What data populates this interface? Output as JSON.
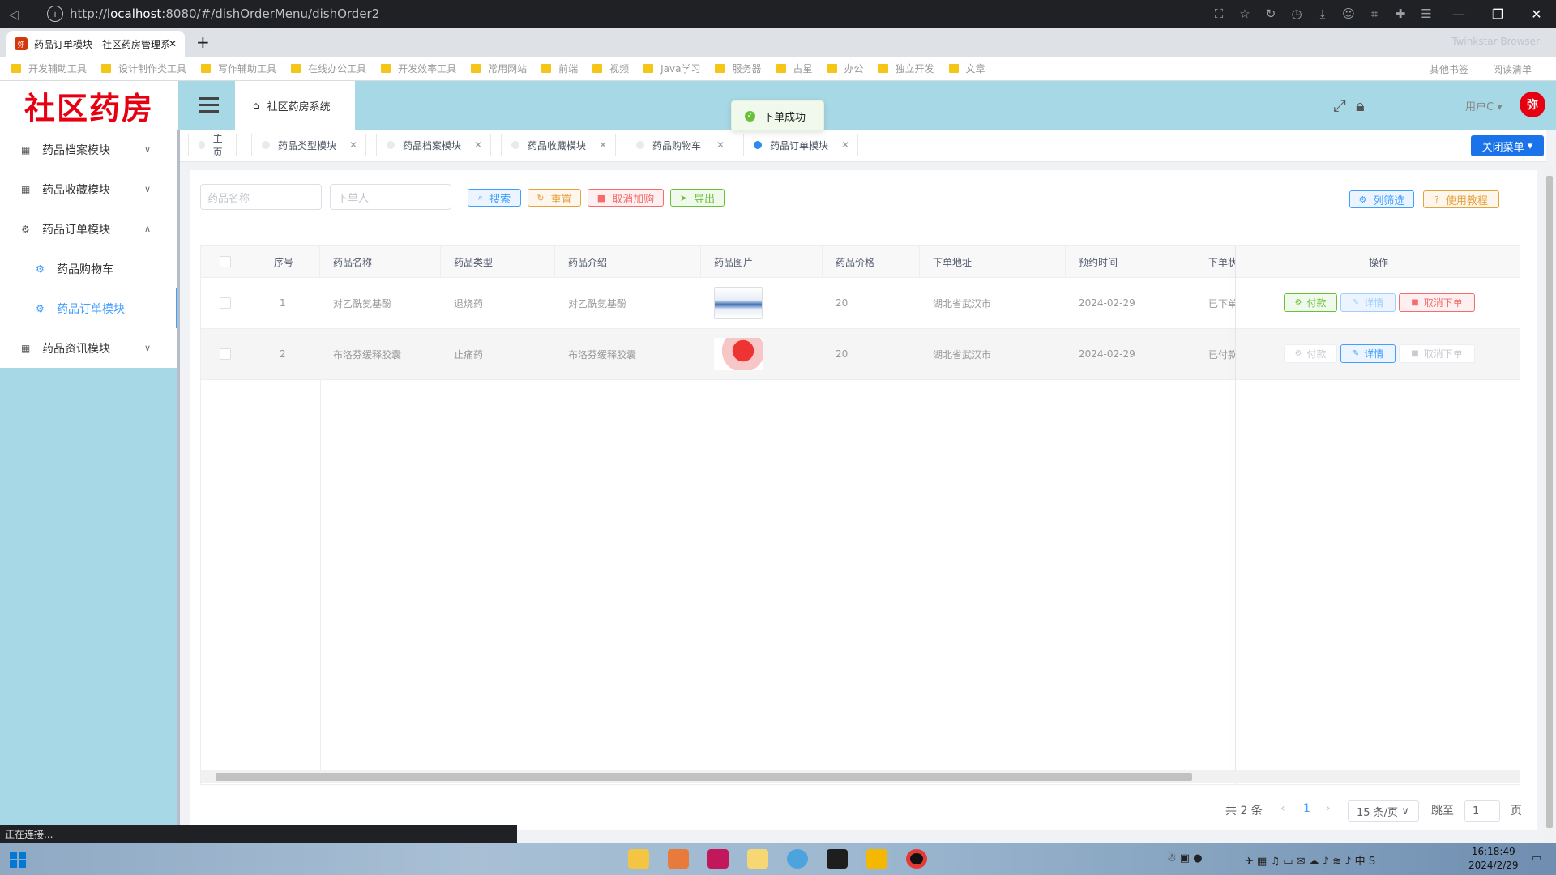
{
  "browser": {
    "url_prefix": "http://",
    "url_host": "localhost",
    "url_rest": ":8080/#/dishOrderMenu/dishOrder2",
    "tab_title": "药品订单模块 - 社区药房管理系统",
    "tab_favicon": "弥",
    "brand": "Twinkstar Browser",
    "status_text": "正在连接..."
  },
  "bookmarks": [
    "开发辅助工具",
    "设计制作类工具",
    "写作辅助工具",
    "在线办公工具",
    "开发效率工具",
    "常用网站",
    "前端",
    "视频",
    "Java学习",
    "服务器",
    "占星",
    "办公",
    "独立开发",
    "文章"
  ],
  "bookmarks_right": [
    "其他书签",
    "阅读清单"
  ],
  "header": {
    "logo": "社区药房",
    "breadcrumb": "社区药房系统",
    "toast": "下单成功",
    "user": "用户C",
    "avatar": "弥"
  },
  "sidebar": {
    "items": [
      {
        "label": "药品档案模块"
      },
      {
        "label": "药品收藏模块"
      },
      {
        "label": "药品订单模块"
      },
      {
        "label": "药品购物车"
      },
      {
        "label": "药品订单模块"
      },
      {
        "label": "药品资讯模块"
      }
    ]
  },
  "tags": {
    "items": [
      {
        "label": "主页"
      },
      {
        "label": "药品类型模块"
      },
      {
        "label": "药品档案模块"
      },
      {
        "label": "药品收藏模块"
      },
      {
        "label": "药品购物车"
      },
      {
        "label": "药品订单模块"
      }
    ],
    "close_menu": "关闭菜单"
  },
  "filters": {
    "drug_name_placeholder": "药品名称",
    "orderer_placeholder": "下单人",
    "search": "搜索",
    "reset": "重置",
    "cancel_purchase": "取消加购",
    "export": "导出",
    "column_filter": "列筛选",
    "tutorial": "使用教程"
  },
  "table": {
    "columns": [
      "序号",
      "药品名称",
      "药品类型",
      "药品介绍",
      "药品图片",
      "药品价格",
      "下单地址",
      "预约时间",
      "下单状态",
      "操作"
    ],
    "rows": [
      {
        "index": "1",
        "name": "对乙酰氨基酚",
        "type": "退烧药",
        "intro": "对乙酰氨基酚",
        "price": "20",
        "address": "湖北省武汉市",
        "time": "2024-02-29",
        "status": "已下单"
      },
      {
        "index": "2",
        "name": "布洛芬缓释胶囊",
        "type": "止痛药",
        "intro": "布洛芬缓释胶囊",
        "price": "20",
        "address": "湖北省武汉市",
        "time": "2024-02-29",
        "status": "已付款"
      }
    ],
    "actions": {
      "pay": "付款",
      "detail": "详情",
      "cancel": "取消下单"
    }
  },
  "pager": {
    "total": "共 2 条",
    "current": "1",
    "size": "15 条/页",
    "goto": "跳至",
    "goto_value": "1",
    "page_unit": "页"
  },
  "taskbar": {
    "time": "16:18:49",
    "date": "2024/2/29"
  }
}
